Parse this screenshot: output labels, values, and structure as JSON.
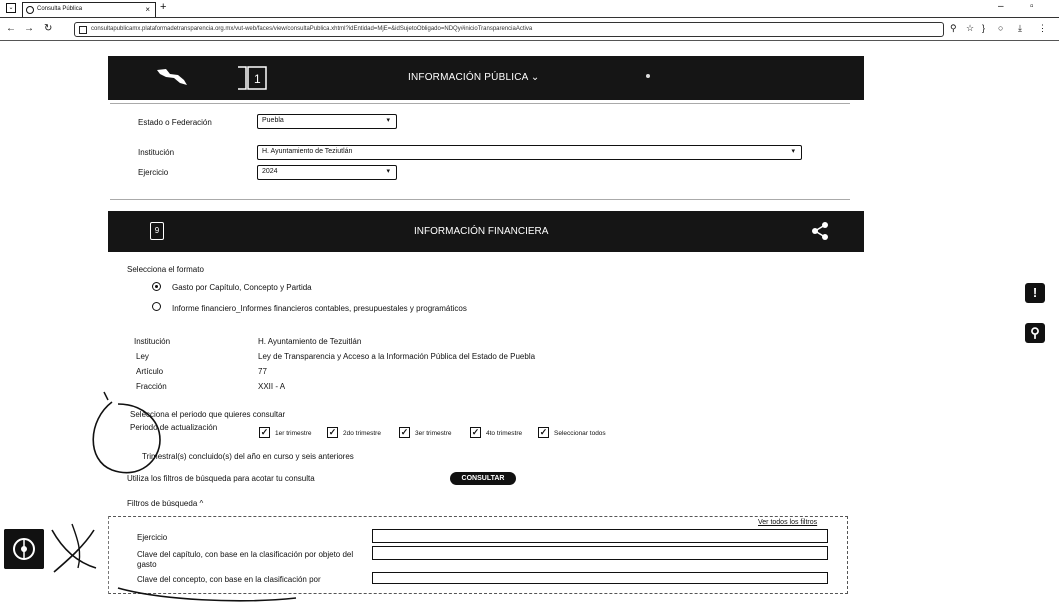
{
  "browser": {
    "tab_title": "Consulta Pública",
    "new_tab": "+",
    "url": "consultapublicamx.plataformadetransparencia.org.mx/vut-web/faces/view/consultaPublica.xhtml?idEntidad=MjE=&idSujetoObligado=NDQy#inicioTransparenciaActiva"
  },
  "header": {
    "title": "INFORMACIÓN PÚBLICA ⌄"
  },
  "form": {
    "estado_label": "Estado o Federación",
    "estado_value": "Puebla",
    "institucion_label": "Institución",
    "institucion_value": "H. Ayuntamiento de Teziutlán",
    "ejercicio_label": "Ejercicio",
    "ejercicio_value": "2024"
  },
  "financial": {
    "title": "INFORMACIÓN FINANCIERA",
    "icon_glyph": "9",
    "select_format_label": "Selecciona el formato",
    "option1": "Gasto por Capítulo, Concepto y Partida",
    "option2": "Informe financiero_Informes financieros contables, presupuestales y programáticos"
  },
  "details": {
    "institucion_label": "Institución",
    "institucion_value": "H. Ayuntamiento de Tezuitlán",
    "ley_label": "Ley",
    "ley_value": "Ley de Transparencia y Acceso a la Información Pública del Estado de Puebla",
    "articulo_label": "Artículo",
    "articulo_value": "77",
    "fraccion_label": "Fracción",
    "fraccion_value": "XXII - A"
  },
  "period": {
    "select_label": "Selecciona el periodo que quieres consultar",
    "update_label": "Periodo de actualización",
    "options": [
      "1er trimestre",
      "2do trimestre",
      "3er trimestre",
      "4to trimestre",
      "Seleccionar todos"
    ],
    "note": "Trimestral(s) concluido(s) del año en curso y seis anteriores",
    "filters_hint": "Utiliza los filtros de búsqueda para acotar tu consulta",
    "consult_button": "CONSULTAR",
    "filters_toggle": "Filtros de búsqueda ^"
  },
  "filters": {
    "see_all": "Ver todos los filtros",
    "ejercicio": "Ejercicio",
    "clave_capitulo": "Clave del capítulo, con base en la clasificación por objeto del gasto",
    "clave_concepto": "Clave del concepto, con base en la clasificación por"
  },
  "side_icons": {
    "info": "!",
    "accessibility": "⚲"
  },
  "colors": {
    "header_bg": "#151515",
    "ink": "#111111"
  }
}
